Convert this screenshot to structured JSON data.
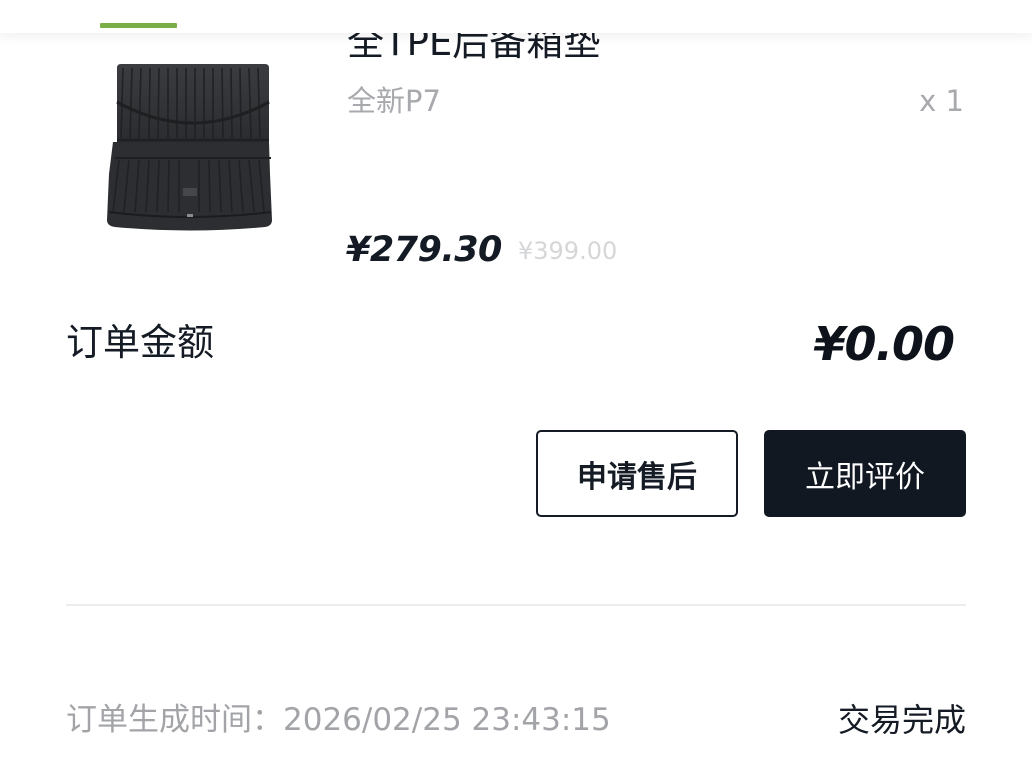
{
  "header": {
    "accent_color": "#7aae47"
  },
  "product": {
    "image_icon": "trunk-mat-image",
    "title": "全TPE后备箱垫",
    "variant": "全新P7",
    "quantity": "x 1",
    "price": "¥279.30",
    "original_price": "¥399.00"
  },
  "order": {
    "amount_label": "订单金额",
    "amount_value": "¥0.00",
    "actions": {
      "after_sale": "申请售后",
      "review": "立即评价"
    },
    "created_label": "订单生成时间：",
    "created_time": "2026/02/25 23:43:15",
    "status": "交易完成"
  }
}
